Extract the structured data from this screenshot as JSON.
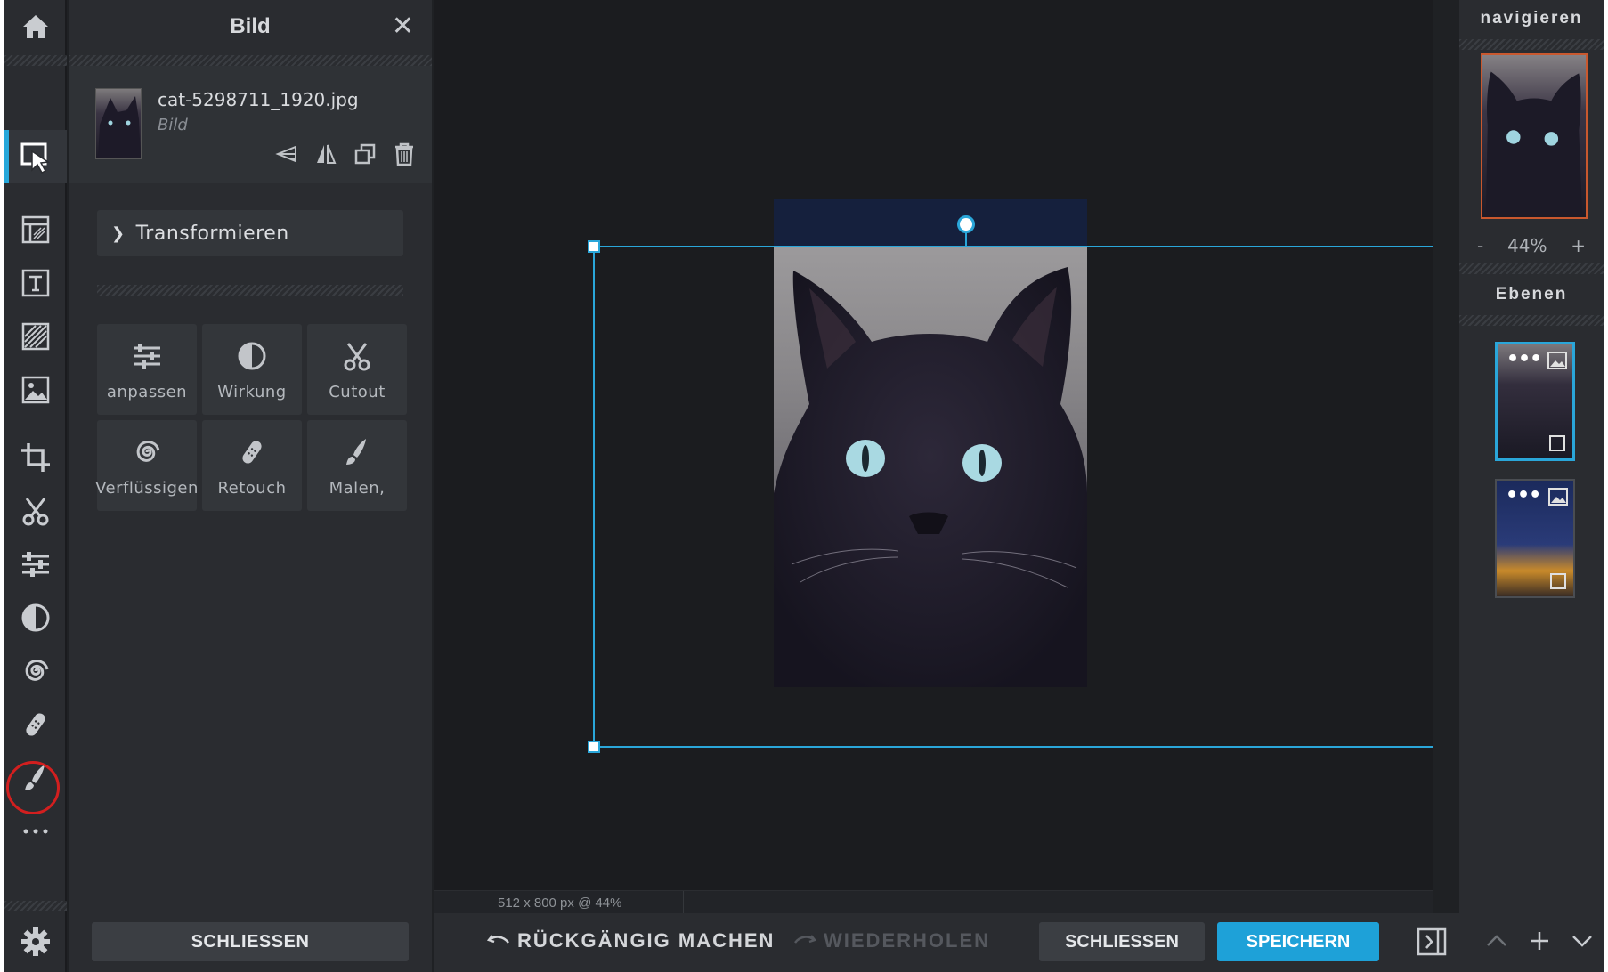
{
  "panel": {
    "title": "Bild",
    "close_glyph": "✕",
    "file_name": "cat-5298711_1920.jpg",
    "file_type": "Bild",
    "section_label": "Transformieren",
    "tiles": [
      {
        "label": "anpassen",
        "icon": "sliders-icon"
      },
      {
        "label": "Wirkung",
        "icon": "contrast-icon"
      },
      {
        "label": "Cutout",
        "icon": "scissors-icon"
      },
      {
        "label": "Verflüssigen",
        "icon": "spiral-icon"
      },
      {
        "label": "Retouch",
        "icon": "bandage-icon"
      },
      {
        "label": "Malen,",
        "icon": "brush-icon"
      }
    ],
    "close_button": "SCHLIESSEN"
  },
  "status": {
    "info": "512 x 800 px @ 44%"
  },
  "bottom": {
    "undo": "RÜCKGÄNGIG MACHEN",
    "redo": "WIEDERHOLEN",
    "close": "SCHLIESSEN",
    "save": "SPEICHERN"
  },
  "right": {
    "navigate_title": "navigieren",
    "zoom_minus": "-",
    "zoom_level": "44%",
    "zoom_plus": "+",
    "layers_title": "Ebenen",
    "layer_menu": "•••"
  },
  "colors": {
    "accent": "#1ea1d8",
    "selection": "#2aa6d9",
    "highlight_circle": "#d21f1f"
  }
}
